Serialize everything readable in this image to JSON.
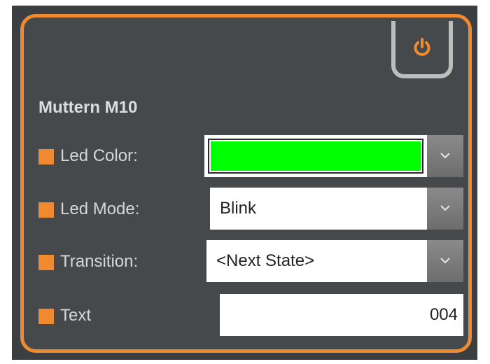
{
  "panel": {
    "title": "Muttern M10",
    "accent_color": "#f08a30",
    "power_icon": "power-icon"
  },
  "rows": [
    {
      "label": "Led Color:",
      "color_value": "#00ff00"
    },
    {
      "label": "Led Mode:",
      "value": "Blink"
    },
    {
      "label": "Transition:",
      "value": "<Next State>"
    },
    {
      "label": "Text",
      "value": "004"
    }
  ]
}
